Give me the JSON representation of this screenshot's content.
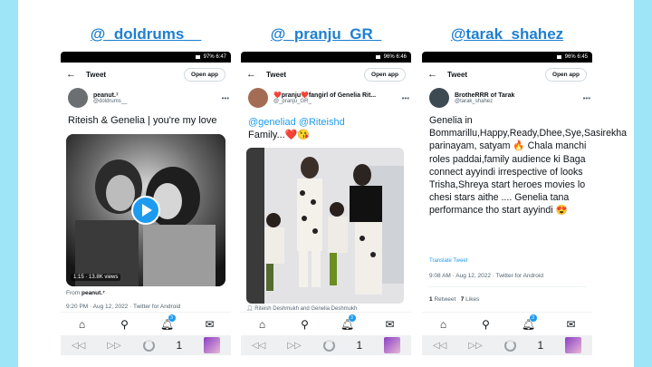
{
  "colors": {
    "side_bars": "#9ee6f7",
    "title": "#1f7fcf",
    "twitter_blue": "#1d9bf0",
    "text": "#0f1419",
    "muted": "#536471"
  },
  "common": {
    "tweet_header": "Tweet",
    "open_app": "Open app",
    "back_icon": "arrow-left-icon",
    "more_icon": "more-icon",
    "nav_icons": [
      "home-icon",
      "search-icon",
      "notifications-icon",
      "messages-icon"
    ],
    "browser_icons": [
      "back-icon",
      "forward-icon",
      "reload-icon",
      "tabs-icon"
    ],
    "tab_count": "1"
  },
  "cards": [
    {
      "title": "@_doldrums__",
      "status_text": "97% 6:47",
      "author": {
        "name": "peanut.⁷",
        "handle": "@doldrums__"
      },
      "tweet_text": "Riteish & Genelia | you're my love",
      "video_duration": "1:15 · 13.8K views",
      "from_label": "From",
      "from_user": "peanut.⁷",
      "meta": "9:20 PM · Aug 12, 2022 · Twitter for Android",
      "notif_badge": "3"
    },
    {
      "title": "@_pranju_GR_",
      "status_text": "96% 6:46",
      "author": {
        "name": "❤️pranju❤️fangirl of Genelia Rit...",
        "handle": "@_pranju_GR_"
      },
      "mentions": "@geneliad @Riteishd",
      "tweet_text": "Family...❤️😘",
      "tag_line": "Riteish Deshmukh and Genelia Deshmukh",
      "notif_badge": "3"
    },
    {
      "title": "@tarak_shahez",
      "status_text": "96% 6:45",
      "author": {
        "name": "BrotheRRR of Tarak",
        "handle": "@tarak_shahez"
      },
      "tweet_text": "Genelia in Bommarillu,Happy,Ready,Dhee,Sye,Sasirekha parinayam, satyam 🔥 Chala manchi roles paddai,family audience ki Baga connect ayyindi irrespective of looks Trisha,Shreya start heroes movies lo  chesi stars aithe .... Genelia tana performance tho start ayyindi 😍",
      "translate": "Translate Tweet",
      "meta": "9:08 AM · Aug 12, 2022 · Twitter for Android",
      "stats": {
        "retweets": "1",
        "retweets_label": "Retweet",
        "likes": "7",
        "likes_label": "Likes"
      },
      "notif_badge": "3"
    }
  ]
}
